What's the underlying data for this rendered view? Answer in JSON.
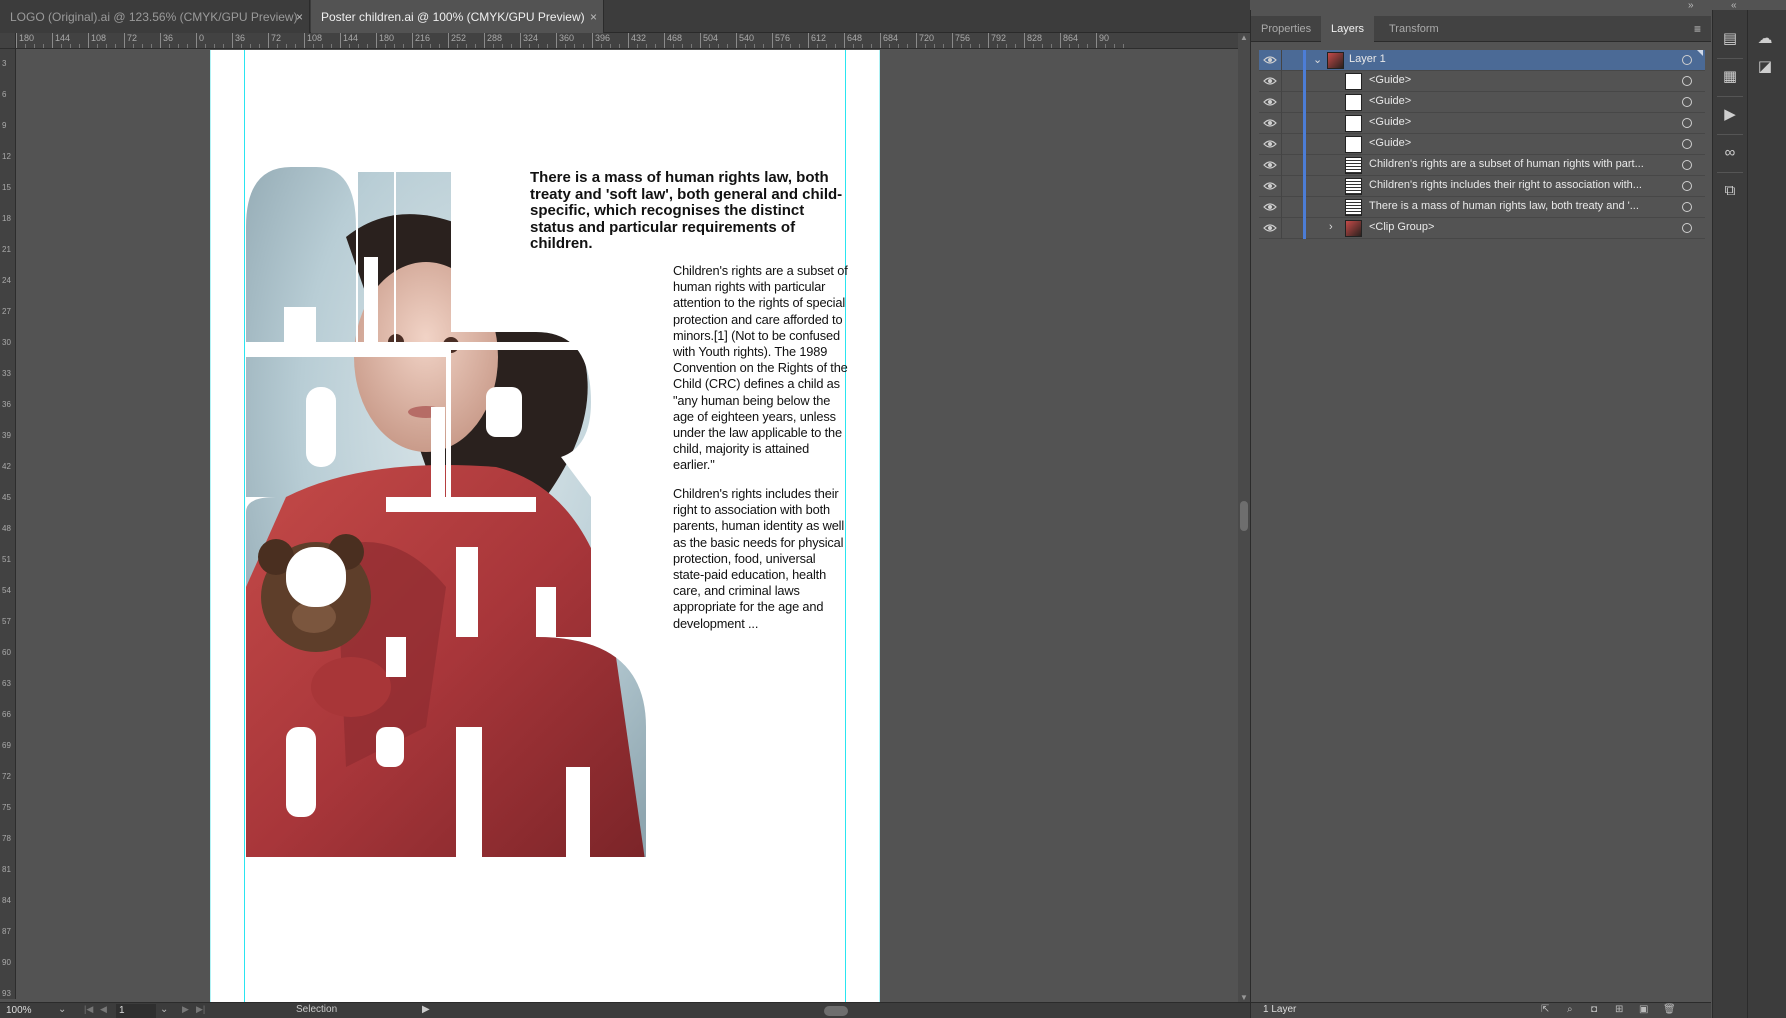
{
  "tabs": [
    {
      "label": "LOGO (Original).ai @ 123.56% (CMYK/GPU Preview)",
      "close": "×"
    },
    {
      "label": "Poster children.ai @ 100% (CMYK/GPU Preview)",
      "close": "×"
    }
  ],
  "panel_collapse": "»",
  "strip_collapse": "«",
  "ruler": {
    "top": [
      "180",
      "144",
      "108",
      "72",
      "36",
      "0",
      "36",
      "72",
      "108",
      "144",
      "180",
      "216",
      "252",
      "288",
      "324",
      "360",
      "396",
      "432",
      "468",
      "504",
      "540",
      "576",
      "612",
      "648",
      "684",
      "720",
      "756",
      "792",
      "828",
      "864",
      "90"
    ],
    "left": [
      "3",
      "6",
      "9",
      "12",
      "15",
      "18",
      "21",
      "24",
      "27",
      "30",
      "33",
      "36",
      "39",
      "42",
      "45",
      "48",
      "51",
      "54",
      "57",
      "60",
      "63",
      "66",
      "69",
      "72",
      "75",
      "78",
      "81",
      "84",
      "87",
      "90",
      "93"
    ]
  },
  "poster": {
    "heading": "There is a mass of human rights law, both treaty and 'soft law', both general and child-specific, which recognises the distinct status and particular requirements of children.",
    "para1": "Children's rights are a subset of human rights with particular attention to the rights of special protection and care afforded to minors.[1] (Not to be confused with Youth rights). The 1989 Convention on the Rights of the Child (CRC) defines a child as \"any human being below the age of eighteen years, unless under the law applicable to the child, majority is attained earlier.\"",
    "para2": "Children's rights includes their right to association with both parents, human identity as well as the basic needs for physical protection, food, universal state-paid education, health care, and criminal laws appropriate for the age and development ..."
  },
  "status": {
    "zoom": "100%",
    "artboard": "1",
    "tool": "Selection",
    "arrow": "▶",
    "nav": [
      "|◀",
      "◀",
      "▶",
      "▶|"
    ]
  },
  "panel": {
    "tabs": [
      "Properties",
      "Layers",
      "Transform"
    ],
    "menu": "≡",
    "layers": [
      {
        "name": "Layer 1",
        "level": 0,
        "expanded": true
      },
      {
        "name": "<Guide>",
        "level": 1
      },
      {
        "name": "<Guide>",
        "level": 1
      },
      {
        "name": "<Guide>",
        "level": 1
      },
      {
        "name": "<Guide>",
        "level": 1
      },
      {
        "name": "Children's rights are a subset of human rights with part...",
        "level": 1
      },
      {
        "name": "Children's rights includes their right to association with...",
        "level": 1
      },
      {
        "name": "There is a mass of human rights law, both treaty and '...",
        "level": 1
      },
      {
        "name": "<Clip Group>",
        "level": 1,
        "collapsed": true
      }
    ],
    "footer": "1 Layer"
  },
  "colors": {
    "guide": "#29e5f0",
    "selection": "#4b6a96",
    "layer_color": "#4c7dd6",
    "coat": "#b23c3c",
    "sky": "#b8cdd5"
  },
  "icons": [
    "eye-icon",
    "chevron-down-icon",
    "chevron-right-icon",
    "target-circle-icon",
    "align-icon",
    "export-icon",
    "play-icon",
    "link-icon",
    "pathfinder-icon",
    "libraries-icon",
    "properties-icon"
  ]
}
